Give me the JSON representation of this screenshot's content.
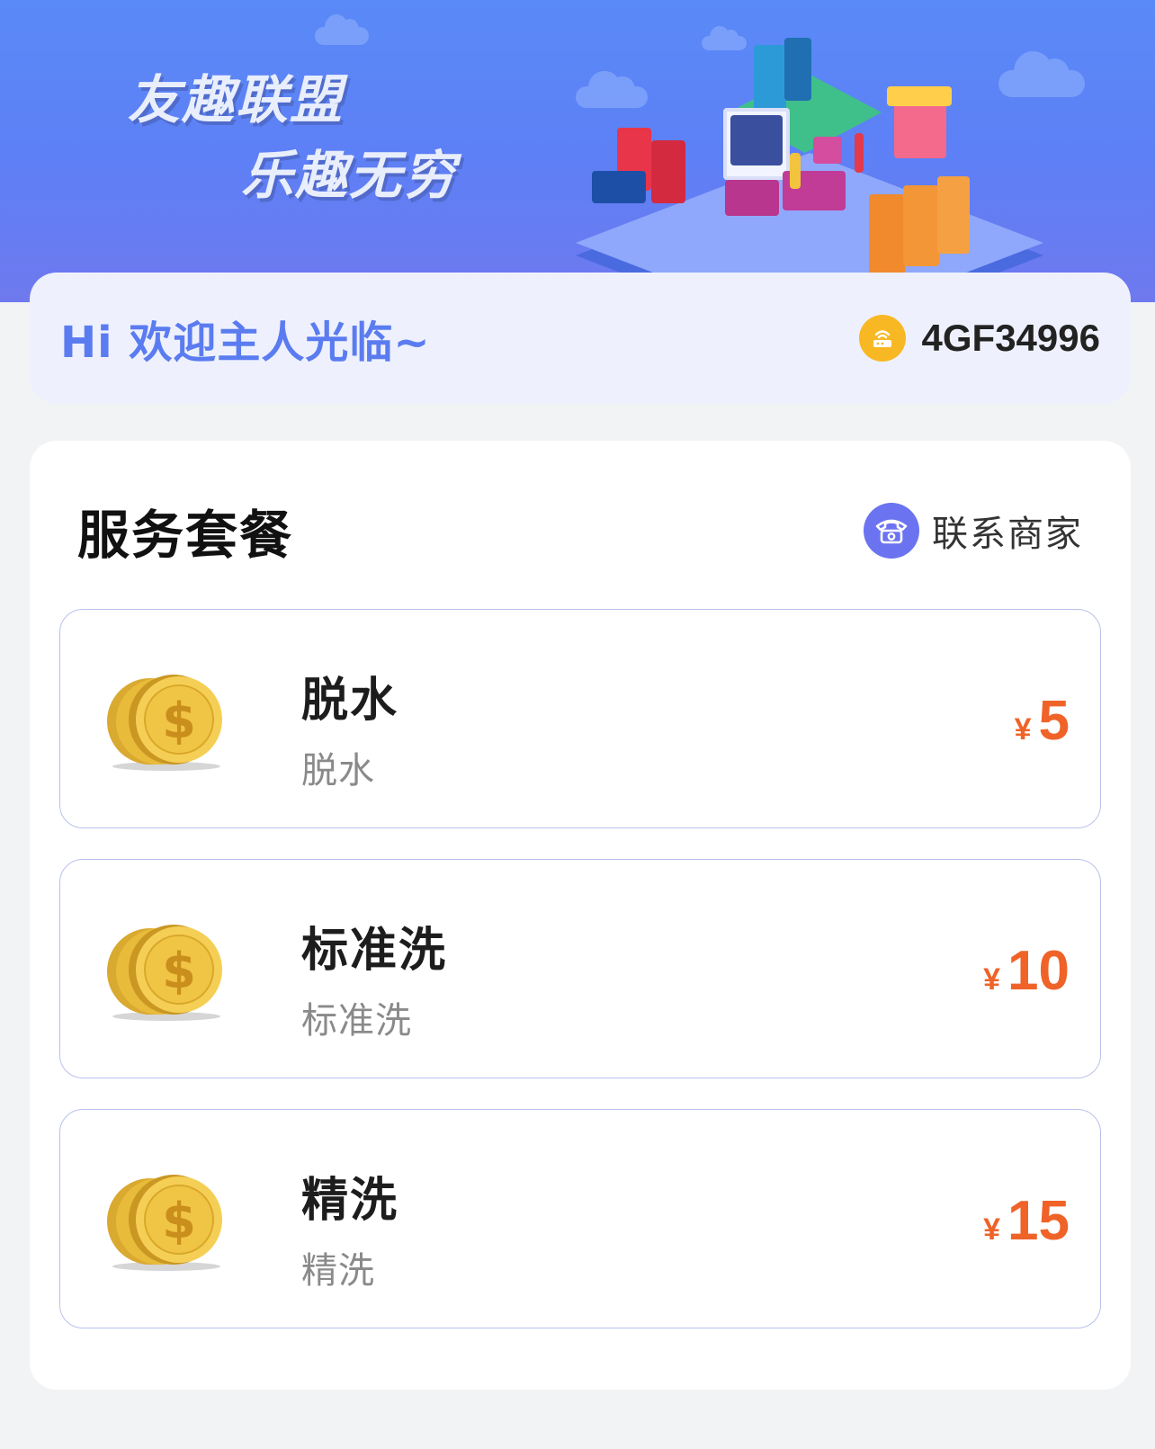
{
  "banner": {
    "slogan_line1": "友趣联盟",
    "slogan_line2": "乐趣无穷"
  },
  "welcome": {
    "greeting": "Hi 欢迎主人光临~",
    "device_icon": "router-icon",
    "device_id": "4GF34996"
  },
  "services": {
    "title": "服务套餐",
    "contact_label": "联系商家",
    "contact_icon": "phone-icon",
    "packages": [
      {
        "name": "脱水",
        "desc": "脱水",
        "currency": "¥",
        "price": "5",
        "icon": "coins-icon"
      },
      {
        "name": "标准洗",
        "desc": "标准洗",
        "currency": "¥",
        "price": "10",
        "icon": "coins-icon"
      },
      {
        "name": "精洗",
        "desc": "精洗",
        "currency": "¥",
        "price": "15",
        "icon": "coins-icon"
      }
    ]
  },
  "colors": {
    "accent": "#5b7cf0",
    "price": "#ef6328",
    "device_badge": "#f8b824",
    "contact_badge": "#6c73f0"
  }
}
